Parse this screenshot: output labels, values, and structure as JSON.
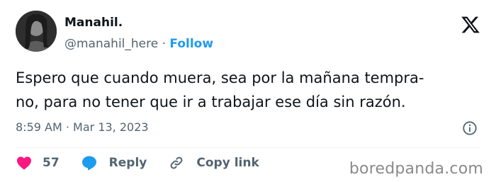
{
  "author": {
    "display_name": "Manahil.",
    "handle": "@manahil_here",
    "separator": "·",
    "follow_label": "Follow"
  },
  "tweet": {
    "lines": [
      "Espero que cuando muera, sea por la mañana tempra-",
      "no, para no tener que ir a trabajar ese día sin razón."
    ],
    "time": "8:59 AM",
    "date_separator": "·",
    "date": "Mar 13, 2023"
  },
  "actions": {
    "like_count": "57",
    "reply_label": "Reply",
    "copy_link_label": "Copy link"
  },
  "watermark": "boredpanda.com",
  "icons": {
    "platform": "x-logo-icon",
    "info": "info-icon",
    "like": "heart-icon",
    "reply": "speech-bubble-icon",
    "copy_link": "link-icon"
  },
  "colors": {
    "follow": "#1d9bf0",
    "like": "#f91880",
    "reply": "#1d9bf0",
    "secondary_text": "#536471"
  }
}
